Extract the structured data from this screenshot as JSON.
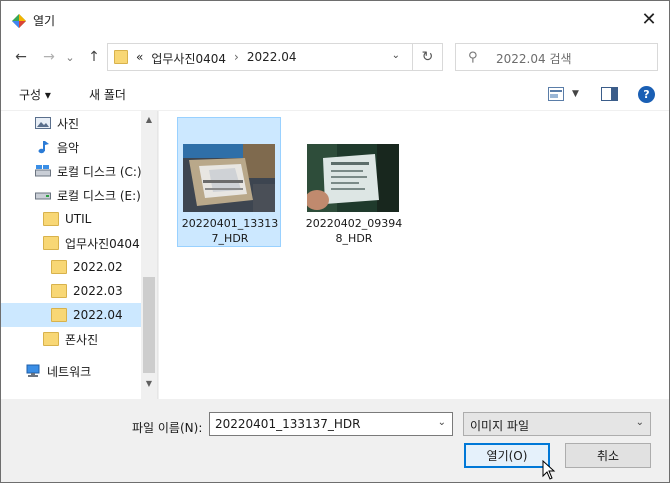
{
  "window": {
    "title": "열기"
  },
  "nav": {
    "back": "←",
    "forward": "→",
    "recent": "⌄",
    "up": "↑"
  },
  "address": {
    "overflow": "«",
    "crumbs": [
      "업무사진0404",
      "2022.04"
    ],
    "separator": "›"
  },
  "search": {
    "placeholder": "2022.04 검색"
  },
  "toolbar": {
    "organize": "구성 ▾",
    "new_folder": "새 폴더"
  },
  "sidebar": {
    "items": [
      {
        "label": "사진",
        "icon": "pictures-icon"
      },
      {
        "label": "음악",
        "icon": "music-icon"
      },
      {
        "label": "로컬 디스크 (C:)",
        "icon": "drive-c-icon"
      },
      {
        "label": "로컬 디스크 (E:)",
        "icon": "drive-e-icon"
      },
      {
        "label": "UTIL",
        "icon": "folder-icon"
      },
      {
        "label": "업무사진0404",
        "icon": "folder-icon"
      },
      {
        "label": "2022.02",
        "icon": "folder-icon"
      },
      {
        "label": "2022.03",
        "icon": "folder-icon"
      },
      {
        "label": "2022.04",
        "icon": "folder-icon",
        "selected": true
      },
      {
        "label": "폰사진",
        "icon": "folder-icon"
      },
      {
        "label": "네트워크",
        "icon": "network-icon"
      }
    ]
  },
  "files": [
    {
      "name": "20220401_133137_HDR",
      "selected": true
    },
    {
      "name": "20220402_093948_HDR",
      "selected": false
    }
  ],
  "footer": {
    "filename_label": "파일 이름(N):",
    "filename_value": "20220401_133137_HDR",
    "filetype": "이미지 파일",
    "open_button": "열기(O)",
    "cancel_button": "취소"
  },
  "colors": {
    "selection": "#cce8ff",
    "selection_border": "#99d1ff",
    "accent": "#0078d7",
    "folder": "#f8d775"
  }
}
